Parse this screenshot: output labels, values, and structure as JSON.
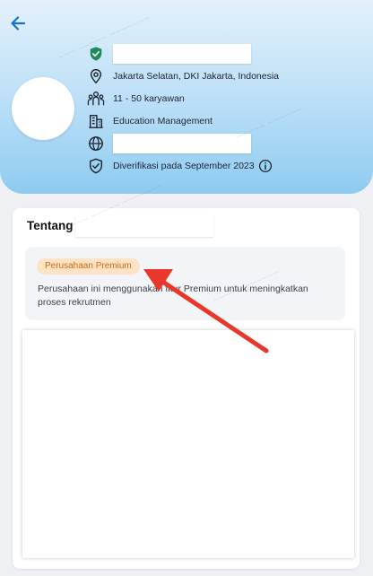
{
  "header": {
    "location": "Jakarta Selatan, DKI Jakarta, Indonesia",
    "employees": "11 - 50 karyawan",
    "industry": "Education Management",
    "verified": "Diverifikasi pada September 2023"
  },
  "about": {
    "title": "Tentang",
    "badge": "Perusahaan Premium",
    "description": "Perusahaan ini menggunakan fitur Premium untuk meningkatkan proses rekrutmen"
  },
  "colors": {
    "accent": "#1673c4",
    "verified_badge": "#1d8a57",
    "badge_bg": "#fde3c6",
    "badge_text": "#d4670e",
    "annotation_arrow": "#e8372b"
  },
  "icons": {
    "back": "arrow-left-icon",
    "verified": "shield-check-icon",
    "location": "map-pin-icon",
    "employees": "people-icon",
    "industry": "building-icon",
    "website": "globe-icon",
    "verified_date": "shield-check-outline-icon",
    "info": "info-circle-icon"
  }
}
